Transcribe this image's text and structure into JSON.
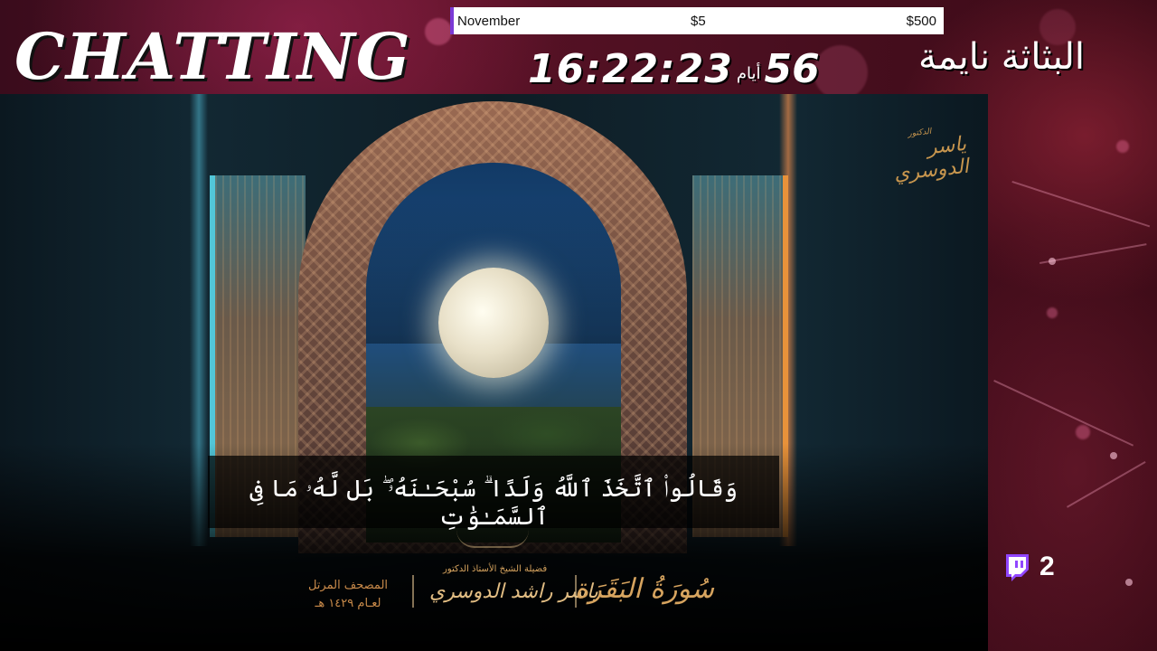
{
  "overlay": {
    "title": "CHATTING",
    "status_arabic": "البثاثة نايمة",
    "goal": {
      "name": "November",
      "current": "$5",
      "target": "$500"
    },
    "uptime": {
      "days": "56",
      "days_label": "أيام",
      "time": "16:22:23"
    },
    "viewers": {
      "count": "2",
      "icon": "twitch-icon"
    }
  },
  "video": {
    "verse": "وَقَالُوا۟ ٱتَّخَذَ ٱللَّهُ وَلَدًا ۗ سُبْحَـٰنَهُۥ ۖ بَل لَّهُۥ مَا فِى ٱلسَّمَـٰوَٰتِ",
    "surah": "سُورَةُ البَقَرَة",
    "reciter_title": "فضيلة الشيخ الأستاذ الدكتور",
    "reciter_name": "ياسر راشد الدوسري",
    "mushaf_line1": "المصحف المرتل",
    "mushaf_line2": "لعـام ١٤٢٩ هـ",
    "watermark_title": "الدكتور",
    "watermark_name": "ياسر الدوسري"
  },
  "colors": {
    "goal_accent": "#7b3ad6",
    "twitch": "#9146ff",
    "calligraphy_gold": "#d7a45f"
  }
}
